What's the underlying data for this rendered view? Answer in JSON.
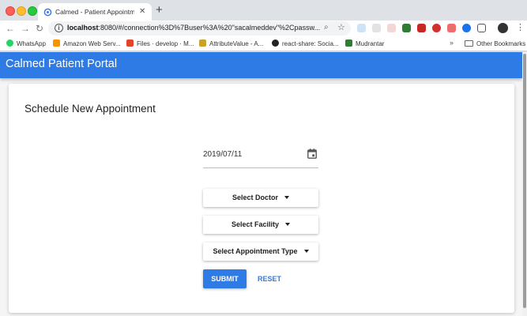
{
  "browser": {
    "tab_title": "Calmed - Patient Appointment",
    "tab_close": "✕",
    "new_tab": "+",
    "url_host": "localhost",
    "url_rest": ":8080/#/connection%3D%7Buser%3A%20\"sacalmeddev\"%2Cpassw...",
    "bookmarks": [
      {
        "label": "WhatsApp",
        "icon": "whatsapp-icon",
        "color": "#25d366"
      },
      {
        "label": "Amazon Web Serv...",
        "icon": "aws-icon",
        "color": "#f79400"
      },
      {
        "label": "Files · develop · M...",
        "icon": "gitlab-icon",
        "color": "#e24329"
      },
      {
        "label": "AttributeValue - A...",
        "icon": "attribute-icon",
        "color": "#c9a227"
      },
      {
        "label": "react-share: Socia...",
        "icon": "github-icon",
        "color": "#222222"
      },
      {
        "label": "Mudrantar",
        "icon": "mudrantar-icon",
        "color": "#2e7d32"
      }
    ],
    "bookmarks_more": "»",
    "other_bookmarks": "Other Bookmarks"
  },
  "app": {
    "title": "Calmed Patient Portal",
    "accent": "#2f7be5"
  },
  "form": {
    "heading": "Schedule New Appointment",
    "date_value": "2019/07/11",
    "doctor_label": "Select Doctor",
    "facility_label": "Select Facility",
    "type_label": "Select Appointment Type",
    "submit_label": "SUBMIT",
    "reset_label": "RESET"
  }
}
